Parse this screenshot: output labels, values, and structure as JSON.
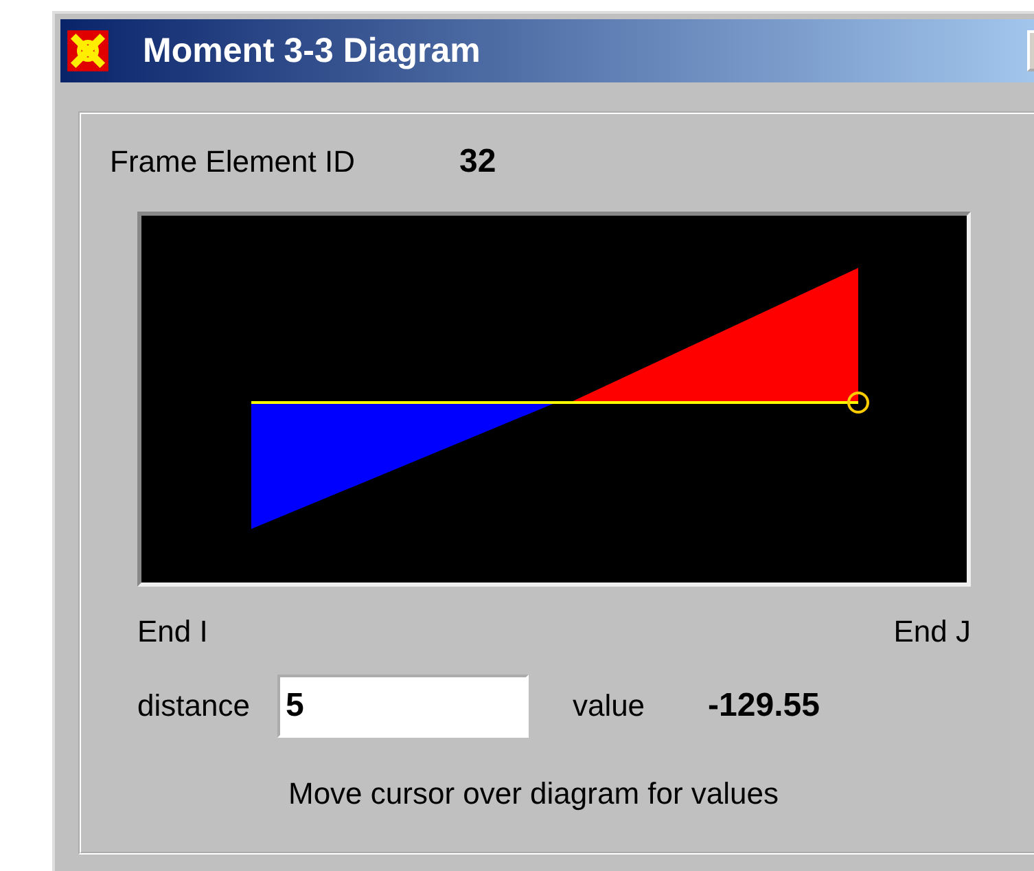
{
  "window": {
    "title": "Moment 3-3 Diagram"
  },
  "frame_element": {
    "label": "Frame Element ID",
    "value": "32"
  },
  "diagram": {
    "start_label": "End I",
    "end_label": "End J"
  },
  "distance": {
    "label": "distance",
    "value": "5"
  },
  "result": {
    "label": "value",
    "value": "-129.55"
  },
  "hint": "Move cursor over diagram for values"
}
